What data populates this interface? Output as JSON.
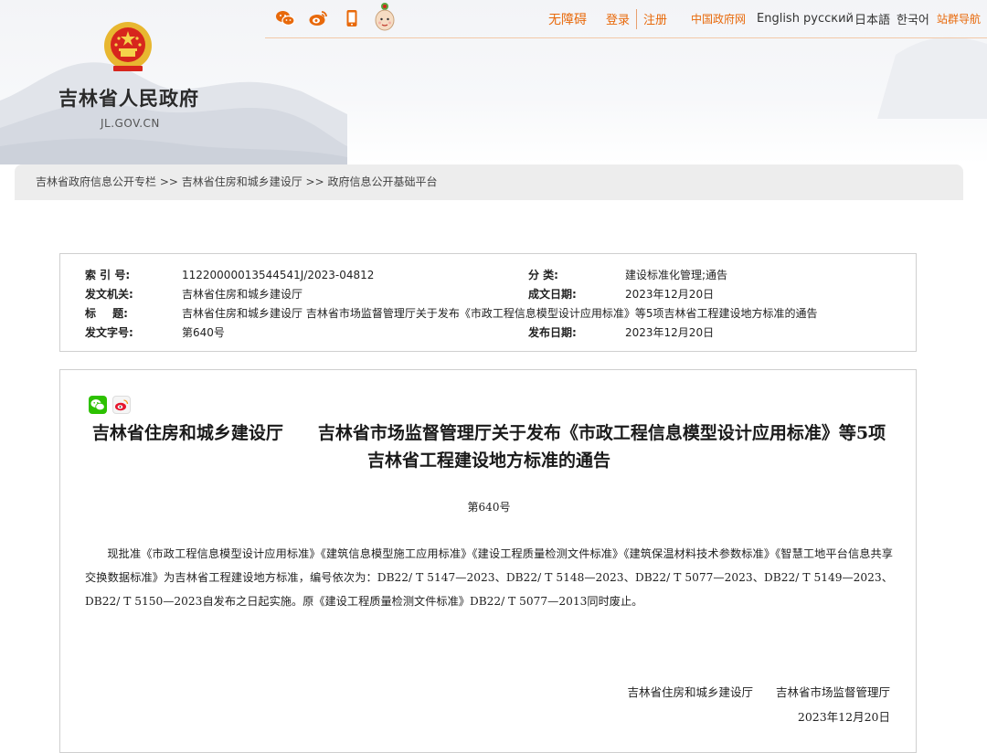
{
  "header": {
    "site_title": "吉林省人民政府",
    "site_domain": "JL.GOV.CN",
    "icons": [
      "wechat-icon",
      "weibo-icon",
      "mobile-icon",
      "mascot-icon",
      "emblem-icon"
    ],
    "top_links": {
      "accessibility": "无障碍",
      "login": "登录",
      "register": "注册",
      "china_gov": "中国政府网",
      "english": "English",
      "russian": "русский",
      "japanese": "日本語",
      "korean": "한국어",
      "site_nav": "站群导航"
    }
  },
  "breadcrumb": {
    "text": "吉林省政府信息公开专栏 >> 吉林省住房和城乡建设厅 >> 政府信息公开基础平台"
  },
  "meta": {
    "index_label": "索 引 号:",
    "index_value": "11220000013544541J/2023-04812",
    "category_label": "分 类:",
    "category_value": "建设标准化管理;通告",
    "issuer_label": "发文机关:",
    "issuer_value": "吉林省住房和城乡建设厅",
    "created_label": "成文日期:",
    "created_value": "2023年12月20日",
    "title_label": "标 题:",
    "title_value": "吉林省住房和城乡建设厅 吉林省市场监督管理厅关于发布《市政工程信息模型设计应用标准》等5项吉林省工程建设地方标准的通告",
    "docno_label": "发文字号:",
    "docno_value": "第640号",
    "published_label": "发布日期:",
    "published_value": "2023年12月20日"
  },
  "article": {
    "title": "吉林省住房和城乡建设厅　　吉林省市场监督管理厅关于发布《市政工程信息模型设计应用标准》等5项吉林省工程建设地方标准的通告",
    "doc_number": "第640号",
    "body": "现批准《市政工程信息模型设计应用标准》《建筑信息模型施工应用标准》《建设工程质量检测文件标准》《建筑保温材料技术参数标准》《智慧工地平台信息共享交换数据标准》为吉林省工程建设地方标准，编号依次为：DB22/ T 5147—2023、DB22/ T 5148—2023、DB22/ T 5077—2023、DB22/ T 5149—2023、DB22/ T 5150—2023自发布之日起实施。原《建设工程质量检测文件标准》DB22/ T 5077—2013同时废止。",
    "signature": "吉林省住房和城乡建设厅　　吉林省市场监督管理厅",
    "date": "2023年12月20日"
  },
  "colors": {
    "accent": "#e8690b",
    "red": "#d7261d",
    "gold": "#e8b730",
    "wechat": "#2dc100",
    "breadcrumb_bg": "#ededed"
  }
}
